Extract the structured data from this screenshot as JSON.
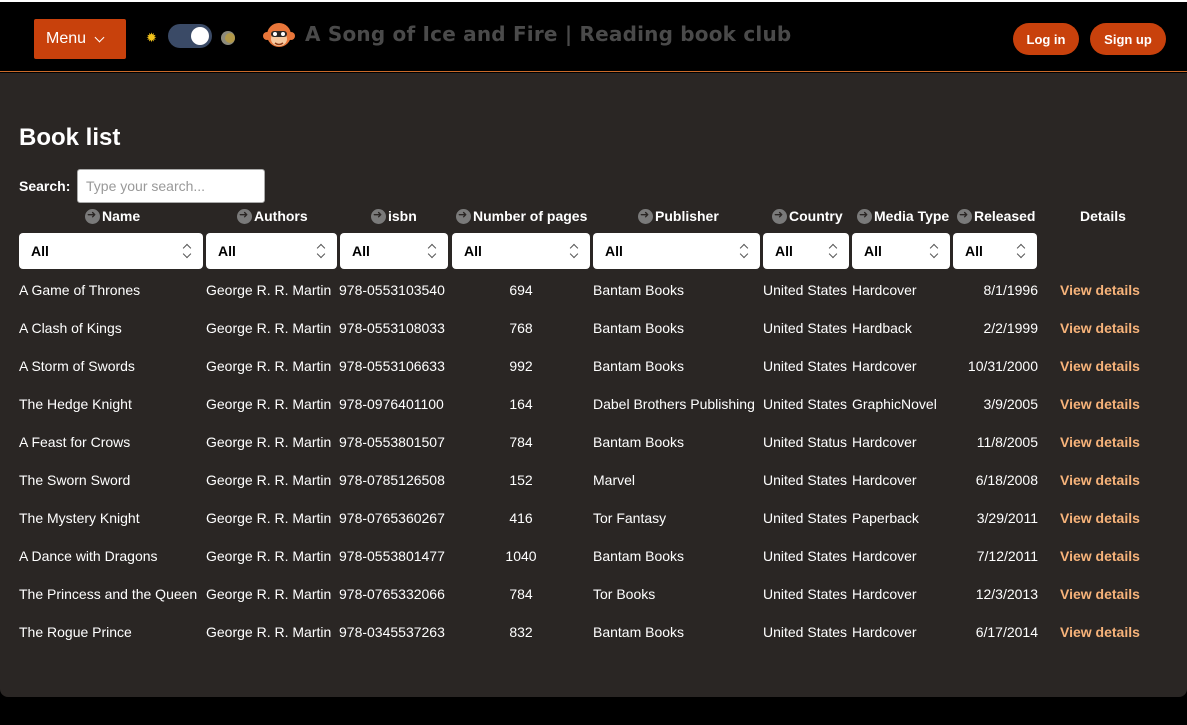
{
  "header": {
    "menu_label": "Menu",
    "site_title": "A Song of Ice and Fire | Reading book club",
    "login_label": "Log in",
    "signup_label": "Sign up",
    "theme_toggle": "dark"
  },
  "main": {
    "title": "Book list",
    "search_label": "Search:",
    "search_placeholder": "Type your search...",
    "search_value": ""
  },
  "columns": [
    {
      "label": "Name",
      "filter": "All"
    },
    {
      "label": "Authors",
      "filter": "All"
    },
    {
      "label": "isbn",
      "filter": "All"
    },
    {
      "label": "Number of pages",
      "filter": "All"
    },
    {
      "label": "Publisher",
      "filter": "All"
    },
    {
      "label": "Country",
      "filter": "All"
    },
    {
      "label": "Media Type",
      "filter": "All"
    },
    {
      "label": "Released",
      "filter": "All"
    },
    {
      "label": "Details"
    }
  ],
  "rows": [
    {
      "name": "A Game of Thrones",
      "authors": "George R. R. Martin",
      "isbn": "978-0553103540",
      "pages": "694",
      "publisher": "Bantam Books",
      "country": "United States",
      "media": "Hardcover",
      "released": "8/1/1996",
      "details": "View details"
    },
    {
      "name": "A Clash of Kings",
      "authors": "George R. R. Martin",
      "isbn": "978-0553108033",
      "pages": "768",
      "publisher": "Bantam Books",
      "country": "United States",
      "media": "Hardback",
      "released": "2/2/1999",
      "details": "View details"
    },
    {
      "name": "A Storm of Swords",
      "authors": "George R. R. Martin",
      "isbn": "978-0553106633",
      "pages": "992",
      "publisher": "Bantam Books",
      "country": "United States",
      "media": "Hardcover",
      "released": "10/31/2000",
      "details": "View details"
    },
    {
      "name": "The Hedge Knight",
      "authors": "George R. R. Martin",
      "isbn": "978-0976401100",
      "pages": "164",
      "publisher": "Dabel Brothers Publishing",
      "country": "United States",
      "media": "GraphicNovel",
      "released": "3/9/2005",
      "details": "View details"
    },
    {
      "name": "A Feast for Crows",
      "authors": "George R. R. Martin",
      "isbn": "978-0553801507",
      "pages": "784",
      "publisher": "Bantam Books",
      "country": "United Status",
      "media": "Hardcover",
      "released": "11/8/2005",
      "details": "View details"
    },
    {
      "name": "The Sworn Sword",
      "authors": "George R. R. Martin",
      "isbn": "978-0785126508",
      "pages": "152",
      "publisher": "Marvel",
      "country": "United States",
      "media": "Hardcover",
      "released": "6/18/2008",
      "details": "View details"
    },
    {
      "name": "The Mystery Knight",
      "authors": "George R. R. Martin",
      "isbn": "978-0765360267",
      "pages": "416",
      "publisher": "Tor Fantasy",
      "country": "United States",
      "media": "Paperback",
      "released": "3/29/2011",
      "details": "View details"
    },
    {
      "name": "A Dance with Dragons",
      "authors": "George R. R. Martin",
      "isbn": "978-0553801477",
      "pages": "1040",
      "publisher": "Bantam Books",
      "country": "United States",
      "media": "Hardcover",
      "released": "7/12/2011",
      "details": "View details"
    },
    {
      "name": "The Princess and the Queen",
      "authors": "George R. R. Martin",
      "isbn": "978-0765332066",
      "pages": "784",
      "publisher": "Tor Books",
      "country": "United States",
      "media": "Hardcover",
      "released": "12/3/2013",
      "details": "View details"
    },
    {
      "name": "The Rogue Prince",
      "authors": "George R. R. Martin",
      "isbn": "978-0345537263",
      "pages": "832",
      "publisher": "Bantam Books",
      "country": "United States",
      "media": "Hardcover",
      "released": "6/17/2014",
      "details": "View details"
    }
  ],
  "colors": {
    "accent": "#c8410c",
    "link": "#f7b37a",
    "panel": "#2a2624",
    "background": "#000000"
  }
}
